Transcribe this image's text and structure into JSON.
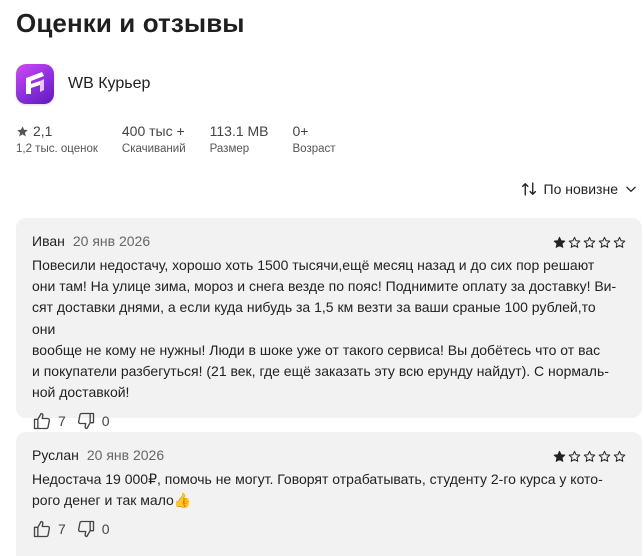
{
  "page": {
    "title": "Оценки и отзывы"
  },
  "app": {
    "name": "WB Курьер",
    "icon": "wb-courier-app-icon",
    "icon_colors": [
      "#d04bf0",
      "#5e1bb8"
    ]
  },
  "stats": [
    {
      "value": "2,1",
      "label": "1,2 тыс. оценок",
      "icon": "star-icon"
    },
    {
      "value": "400 тыс +",
      "label": "Скачиваний"
    },
    {
      "value": "113.1 MB",
      "label": "Размер"
    },
    {
      "value": "0+",
      "label": "Возраст"
    }
  ],
  "sort": {
    "label": "По новизне",
    "icon": "sort-icon"
  },
  "reviews": [
    {
      "author": "Иван",
      "date": "20 янв 2026",
      "rating": 1,
      "max_rating": 5,
      "lines": [
        "Повесили недостачу, хорошо хоть 1500 тысячи,ещё месяц назад и до сих пор решают",
        "они там! На улице зима, мороз и снега везде по пояс! Поднимите оплату за доставку! Ви-",
        "сят доставки днями, а если куда нибудь за 1,5 км везти за ваши сраные 100 рублей,то они",
        "вообще не кому не нужны! Люди в шоке уже от такого сервиса! Вы добётесь что от вас",
        "и покупатели разбегуться! (21 век, где ещё заказать эту всю ерунду найдут). С нормаль-",
        "ной доставкой!"
      ],
      "likes": "7",
      "dislikes": "0"
    },
    {
      "author": "Руслан",
      "date": "20 янв 2026",
      "rating": 1,
      "max_rating": 5,
      "lines": [
        "Недостача 19 000₽, помочь не могут. Говорят отрабатывать, студенту 2-го курса у кото-",
        "рого денег и так мало👍"
      ],
      "likes": "7",
      "dislikes": "0"
    }
  ],
  "colors": {
    "card_bg": "#f2f2f3",
    "star": "#222222"
  }
}
